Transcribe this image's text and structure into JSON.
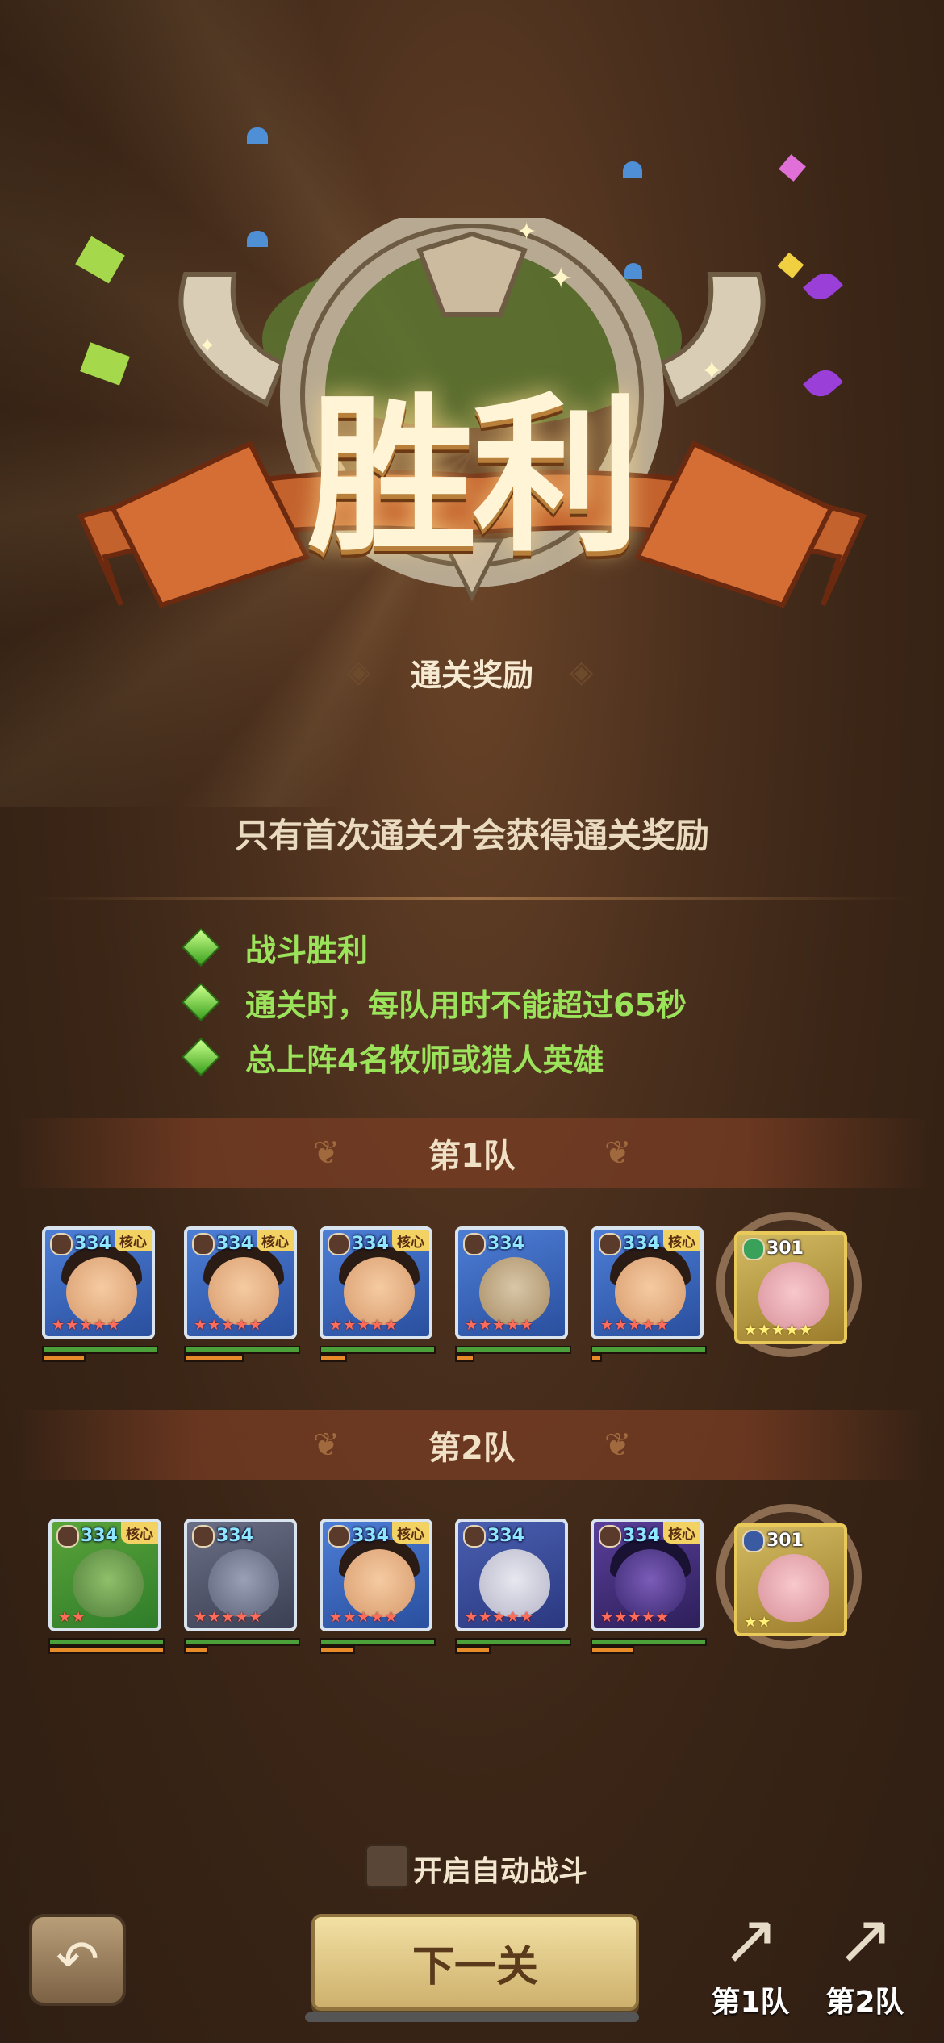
{
  "victory": {
    "title": "胜利",
    "reward_label": "通关奖励"
  },
  "notice": "只有首次通关才会获得通关奖励",
  "conditions": [
    "战斗胜利",
    "通关时，每队用时不能超过65秒",
    "总上阵4名牧师或猎人英雄"
  ],
  "teams": [
    {
      "name": "第1队",
      "heroes": [
        {
          "level": "334",
          "core": "核心",
          "stars": "★★★★★",
          "icon": "axe-class-icon"
        },
        {
          "level": "334",
          "core": "核心",
          "stars": "★★★★★",
          "icon": "shield-class-icon"
        },
        {
          "level": "334",
          "core": "核心",
          "stars": "★★★★★",
          "icon": "staff-class-icon"
        },
        {
          "level": "334",
          "core": "",
          "stars": "★★★★★",
          "icon": "beast-class-icon"
        },
        {
          "level": "334",
          "core": "核心",
          "stars": "★★★★★",
          "icon": "cross-class-icon"
        }
      ],
      "pet": {
        "level": "301",
        "stars": "★★★★★"
      }
    },
    {
      "name": "第2队",
      "heroes": [
        {
          "level": "334",
          "core": "核心",
          "stars": "★★",
          "icon": "paw-class-icon"
        },
        {
          "level": "334",
          "core": "",
          "stars": "★★★★★",
          "icon": "shield-class-icon"
        },
        {
          "level": "334",
          "core": "核心",
          "stars": "★★★★★",
          "icon": "bow-class-icon"
        },
        {
          "level": "334",
          "core": "",
          "stars": "★★★★★",
          "icon": "cross-class-icon"
        },
        {
          "level": "334",
          "core": "核心",
          "stars": "★★★★★",
          "icon": "cross-class-icon"
        }
      ],
      "pet": {
        "level": "301",
        "stars": "★★"
      }
    }
  ],
  "auto_battle_label": "开启自动战斗",
  "next_button": "下一关",
  "stats_buttons": [
    "第1队",
    "第2队"
  ],
  "icons": {
    "back": "back-arrow-icon",
    "stats": "chart-up-icon"
  },
  "colors": {
    "condition_text": "#9be35b",
    "level_text": "#8fe7ff",
    "accent_gold": "#f3d264"
  }
}
